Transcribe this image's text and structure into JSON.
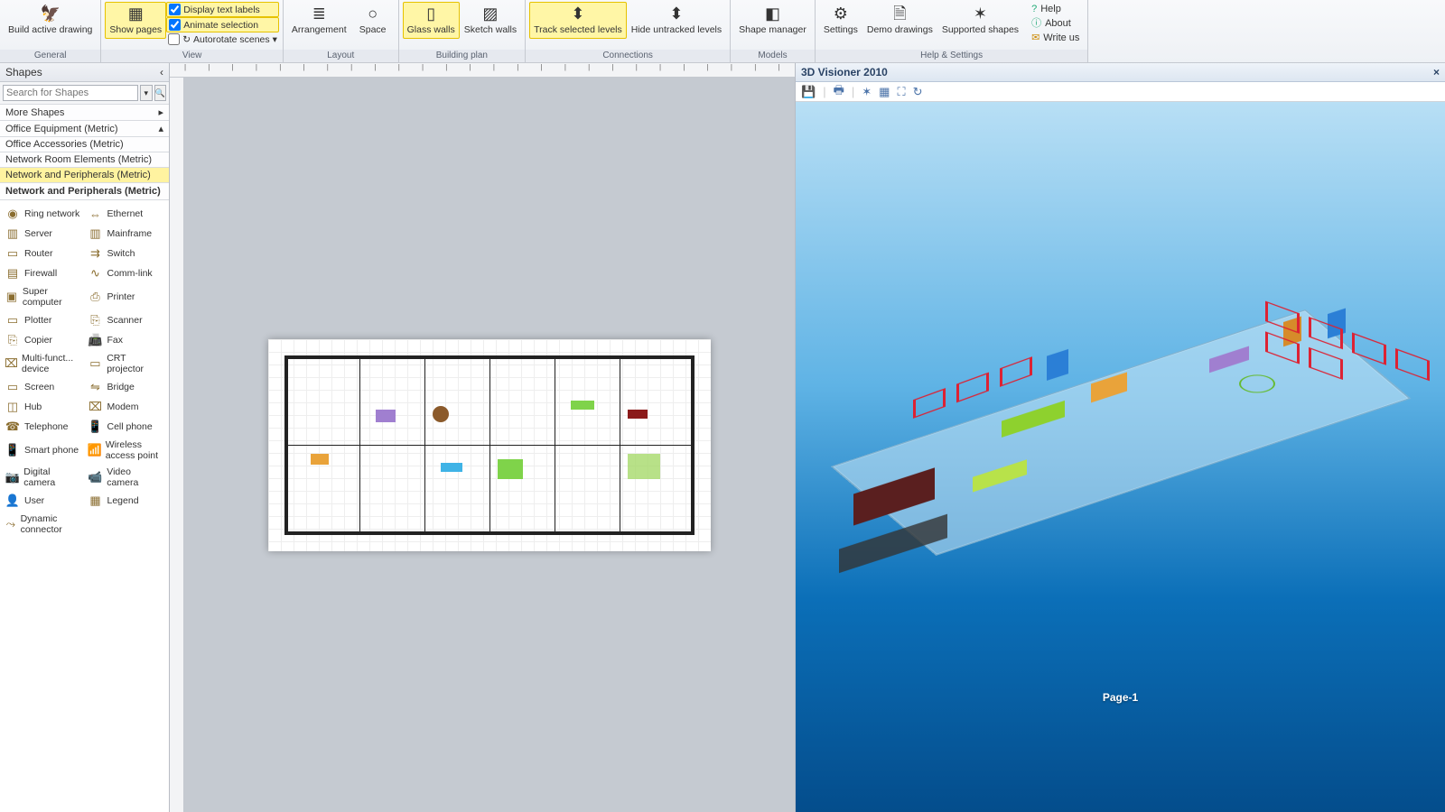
{
  "ribbon": {
    "groups": [
      {
        "label": "General",
        "items": [
          {
            "label": "Build active drawing",
            "icon": "🦅"
          }
        ]
      },
      {
        "label": "View",
        "items": [
          {
            "label": "Show pages",
            "icon": "▦",
            "hi": true
          }
        ],
        "checks": [
          {
            "label": "Display text labels",
            "hi": true
          },
          {
            "label": "Animate selection",
            "hi": true
          },
          {
            "label": "Autorotate scenes",
            "hi": false
          }
        ]
      },
      {
        "label": "Layout",
        "items": [
          {
            "label": "Arrangement",
            "icon": "≡"
          },
          {
            "label": "Space",
            "icon": "○"
          }
        ]
      },
      {
        "label": "Building plan",
        "items": [
          {
            "label": "Glass walls",
            "icon": "▯",
            "hi": true
          },
          {
            "label": "Sketch walls",
            "icon": "▨"
          }
        ]
      },
      {
        "label": "Connections",
        "items": [
          {
            "label": "Track selected levels",
            "icon": "↕",
            "hi": true
          },
          {
            "label": "Hide untracked levels",
            "icon": "↕"
          }
        ]
      },
      {
        "label": "Models",
        "items": [
          {
            "label": "Shape manager",
            "icon": "◧"
          }
        ]
      },
      {
        "label": "Help & Settings",
        "items": [
          {
            "label": "Settings",
            "icon": "⚙"
          },
          {
            "label": "Demo drawings",
            "icon": "🗎"
          },
          {
            "label": "Supported shapes",
            "icon": "✶"
          }
        ],
        "links": [
          {
            "label": "Help",
            "icon": "?"
          },
          {
            "label": "About",
            "icon": "ⓘ"
          },
          {
            "label": "Write us",
            "icon": "✉"
          }
        ]
      }
    ]
  },
  "shapes": {
    "title": "Shapes",
    "search_placeholder": "Search for Shapes",
    "more": "More Shapes",
    "categories": [
      {
        "label": "Office Equipment (Metric)"
      },
      {
        "label": "Office Accessories (Metric)"
      },
      {
        "label": "Network Room Elements (Metric)"
      },
      {
        "label": "Network and Peripherals (Metric)",
        "selected": true
      }
    ],
    "active_title": "Network and Peripherals (Metric)",
    "items": [
      [
        "Ring network",
        "Ethernet"
      ],
      [
        "Server",
        "Mainframe"
      ],
      [
        "Router",
        "Switch"
      ],
      [
        "Firewall",
        "Comm-link"
      ],
      [
        "Super computer",
        "Printer"
      ],
      [
        "Plotter",
        "Scanner"
      ],
      [
        "Copier",
        "Fax"
      ],
      [
        "Multi-funct... device",
        "CRT projector"
      ],
      [
        "Screen",
        "Bridge"
      ],
      [
        "Hub",
        "Modem"
      ],
      [
        "Telephone",
        "Cell phone"
      ],
      [
        "Smart phone",
        "Wireless access point"
      ],
      [
        "Digital camera",
        "Video camera"
      ],
      [
        "User",
        "Legend"
      ],
      [
        "Dynamic connector",
        ""
      ]
    ]
  },
  "visioner": {
    "title": "3D Visioner 2010",
    "toolbar_icons": [
      "save-icon",
      "print-icon",
      "camera-icon",
      "grid-icon",
      "fullscreen-icon",
      "rotate-icon"
    ],
    "page_label": "Page-1"
  }
}
